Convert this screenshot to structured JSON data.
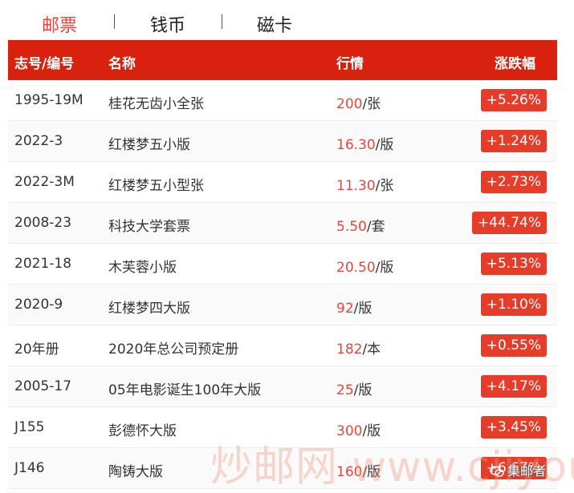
{
  "tabs": [
    {
      "label": "邮票",
      "active": true
    },
    {
      "label": "钱币",
      "active": false
    },
    {
      "label": "磁卡",
      "active": false
    }
  ],
  "table": {
    "headers": {
      "id": "志号/编号",
      "name": "名称",
      "price": "行情",
      "change": "涨跌幅"
    },
    "rows": [
      {
        "id": "1995-19M",
        "name": "桂花无齿小全张",
        "price": "200",
        "unit": "/张",
        "change": "+5.26%"
      },
      {
        "id": "2022-3",
        "name": "红楼梦五小版",
        "price": "16.30",
        "unit": "/版",
        "change": "+1.24%"
      },
      {
        "id": "2022-3M",
        "name": "红楼梦五小型张",
        "price": "11.30",
        "unit": "/张",
        "change": "+2.73%"
      },
      {
        "id": "2008-23",
        "name": "科技大学套票",
        "price": "5.50",
        "unit": "/套",
        "change": "+44.74%"
      },
      {
        "id": "2021-18",
        "name": "木芙蓉小版",
        "price": "20.50",
        "unit": "/版",
        "change": "+5.13%"
      },
      {
        "id": "2020-9",
        "name": "红楼梦四大版",
        "price": "92",
        "unit": "/版",
        "change": "+1.10%"
      },
      {
        "id": "20年册",
        "name": "2020年总公司预定册",
        "price": "182",
        "unit": "/本",
        "change": "+0.55%"
      },
      {
        "id": "2005-17",
        "name": "05年电影诞生100年大版",
        "price": "25",
        "unit": "/版",
        "change": "+4.17%"
      },
      {
        "id": "J155",
        "name": "彭德怀大版",
        "price": "300",
        "unit": "/版",
        "change": "+3.45%"
      },
      {
        "id": "J146",
        "name": "陶铸大版",
        "price": "160",
        "unit": "/版",
        "change": "+6.67%"
      }
    ]
  },
  "watermark": {
    "text": "炒邮网 www.cjiyou.net",
    "wechat": "集邮者"
  },
  "colors": {
    "header_bg": "#d8220e",
    "accent": "#e3473d",
    "badge_bg": "#e53d2a"
  }
}
